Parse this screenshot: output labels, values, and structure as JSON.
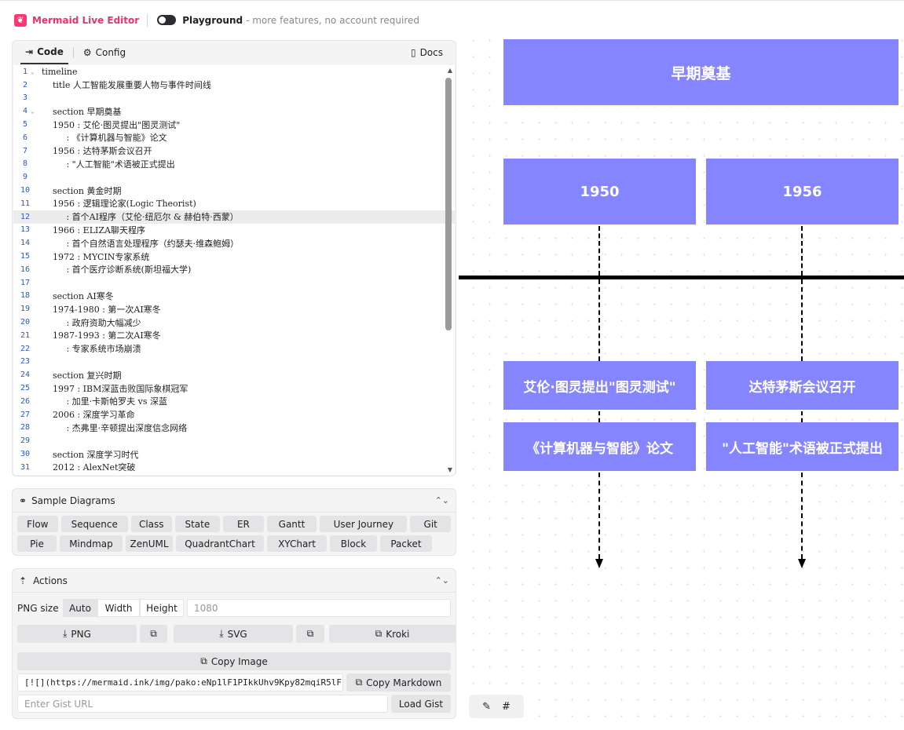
{
  "header": {
    "brand": "Mermaid Live Editor",
    "playground_title": "Playground",
    "playground_sub": "- more features, no account required"
  },
  "code_panel": {
    "tabs": {
      "code": "Code",
      "config": "Config",
      "docs": "Docs"
    },
    "lines": [
      {
        "n": "1",
        "text": "timeline",
        "fold": true
      },
      {
        "n": "2",
        "text": "    title 人工智能发展重要人物与事件时间线"
      },
      {
        "n": "3",
        "text": ""
      },
      {
        "n": "4",
        "text": "    section 早期奠基",
        "fold": true
      },
      {
        "n": "5",
        "text": "    1950 : 艾伦·图灵提出\"图灵测试\""
      },
      {
        "n": "6",
        "text": "         : 《计算机器与智能》论文"
      },
      {
        "n": "7",
        "text": "    1956 : 达特茅斯会议召开"
      },
      {
        "n": "8",
        "text": "         : \"人工智能\"术语被正式提出"
      },
      {
        "n": "9",
        "text": ""
      },
      {
        "n": "10",
        "text": "    section 黄金时期"
      },
      {
        "n": "11",
        "text": "    1956 : 逻辑理论家(Logic Theorist)"
      },
      {
        "n": "12",
        "text": "         : 首个AI程序（艾伦·纽厄尔 & 赫伯特·西蒙）",
        "highlight": true
      },
      {
        "n": "13",
        "text": "    1966 : ELIZA聊天程序"
      },
      {
        "n": "14",
        "text": "         : 首个自然语言处理程序（约瑟夫·维森鲍姆）"
      },
      {
        "n": "15",
        "text": "    1972 : MYCIN专家系统"
      },
      {
        "n": "16",
        "text": "         : 首个医疗诊断系统(斯坦福大学)"
      },
      {
        "n": "17",
        "text": ""
      },
      {
        "n": "18",
        "text": "    section AI寒冬"
      },
      {
        "n": "19",
        "text": "    1974-1980 : 第一次AI寒冬"
      },
      {
        "n": "20",
        "text": "         : 政府资助大幅减少"
      },
      {
        "n": "21",
        "text": "    1987-1993 : 第二次AI寒冬"
      },
      {
        "n": "22",
        "text": "         : 专家系统市场崩溃"
      },
      {
        "n": "23",
        "text": ""
      },
      {
        "n": "24",
        "text": "    section 复兴时期"
      },
      {
        "n": "25",
        "text": "    1997 : IBM深蓝击败国际象棋冠军"
      },
      {
        "n": "26",
        "text": "         : 加里·卡斯帕罗夫 vs 深蓝"
      },
      {
        "n": "27",
        "text": "    2006 : 深度学习革命"
      },
      {
        "n": "28",
        "text": "         : 杰弗里·辛顿提出深度信念网络"
      },
      {
        "n": "29",
        "text": ""
      },
      {
        "n": "30",
        "text": "    section 深度学习时代"
      },
      {
        "n": "31",
        "text": "    2012 : AlexNet突破"
      }
    ]
  },
  "samples": {
    "title": "Sample Diagrams",
    "row1": [
      "Flow",
      "Sequence",
      "Class",
      "State",
      "ER",
      "Gantt",
      "User Journey",
      "Git"
    ],
    "row2": [
      "Pie",
      "Mindmap",
      "ZenUML",
      "QuadrantChart",
      "XYChart",
      "Block",
      "Packet"
    ]
  },
  "actions": {
    "title": "Actions",
    "png_size_label": "PNG size",
    "size_modes": [
      "Auto",
      "Width",
      "Height"
    ],
    "size_value_placeholder": "1080",
    "png": "PNG",
    "svg": "SVG",
    "kroki": "Kroki",
    "copy_image": "Copy Image",
    "markdown_value": "[![](https://mermaid.ink/img/pako:eNp1lF1PIkkUhv9Kpy82mqiR5lF",
    "copy_markdown": "Copy Markdown",
    "gist_placeholder": "Enter Gist URL",
    "load_gist": "Load Gist"
  },
  "preview": {
    "section": "早期奠基",
    "periods": [
      {
        "year": "1950",
        "events": [
          "艾伦·图灵提出\"图灵测试\"",
          "《计算机器与智能》论文"
        ]
      },
      {
        "year": "1956",
        "events": [
          "达特茅斯会议召开",
          "\"人工智能\"术语被正式提出"
        ]
      }
    ],
    "node_color": "#8585ff"
  },
  "colors": {
    "brand": "#e8336a",
    "accent": "#8585ff"
  }
}
